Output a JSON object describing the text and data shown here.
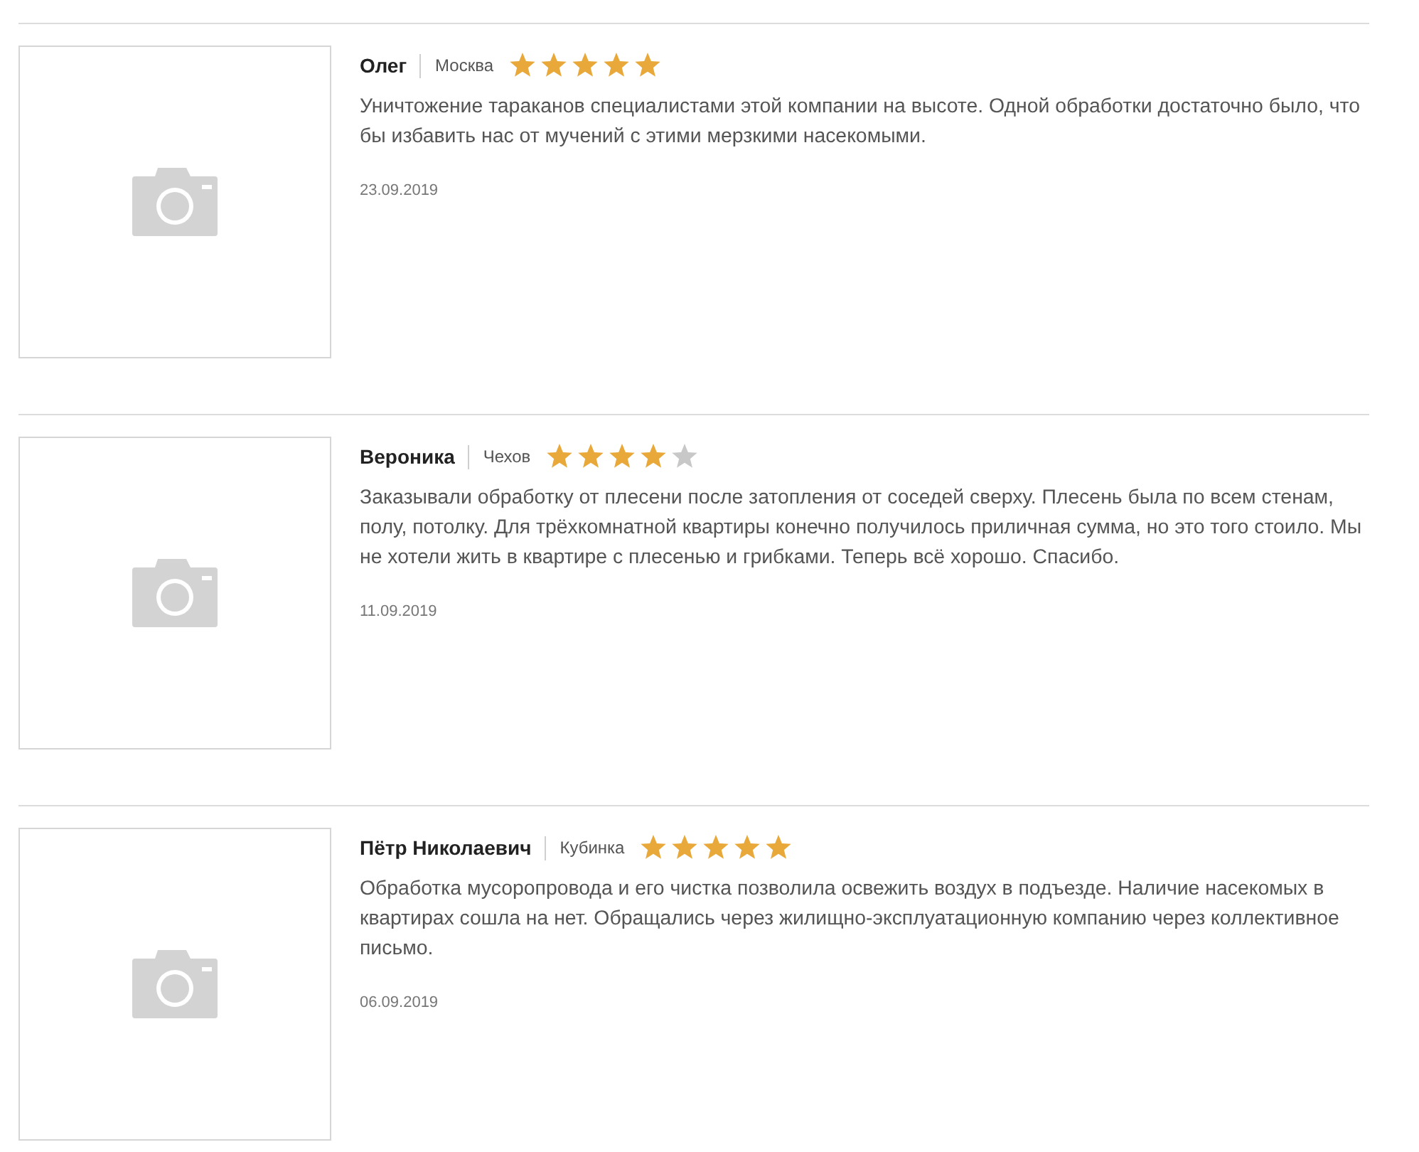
{
  "reviews": [
    {
      "name": "Олег",
      "city": "Москва",
      "stars": 5,
      "text": "Уничтожение тараканов специалистами этой компании на высоте. Одной обработки достаточно было, что бы избавить нас от мучений с этими мерзкими насекомыми.",
      "date": "23.09.2019"
    },
    {
      "name": "Вероника",
      "city": "Чехов",
      "stars": 4,
      "text": "Заказывали обработку от плесени после затопления от соседей сверху. Плесень была по всем стенам, полу, потолку. Для трёхкомнатной квартиры конечно получилось приличная сумма, но это того стоило. Мы не хотели жить в квартире с плесенью и грибками. Теперь всё хорошо. Спасибо.",
      "date": "11.09.2019"
    },
    {
      "name": "Пётр Николаевич",
      "city": "Кубинка",
      "stars": 5,
      "text": "Обработка мусоропровода и его чистка позволила освежить воздух в подъезде. Наличие насекомых в квартирах сошла на нет. Обращались через жилищно-эксплуатационную компанию через коллективное письмо.",
      "date": "06.09.2019"
    }
  ]
}
